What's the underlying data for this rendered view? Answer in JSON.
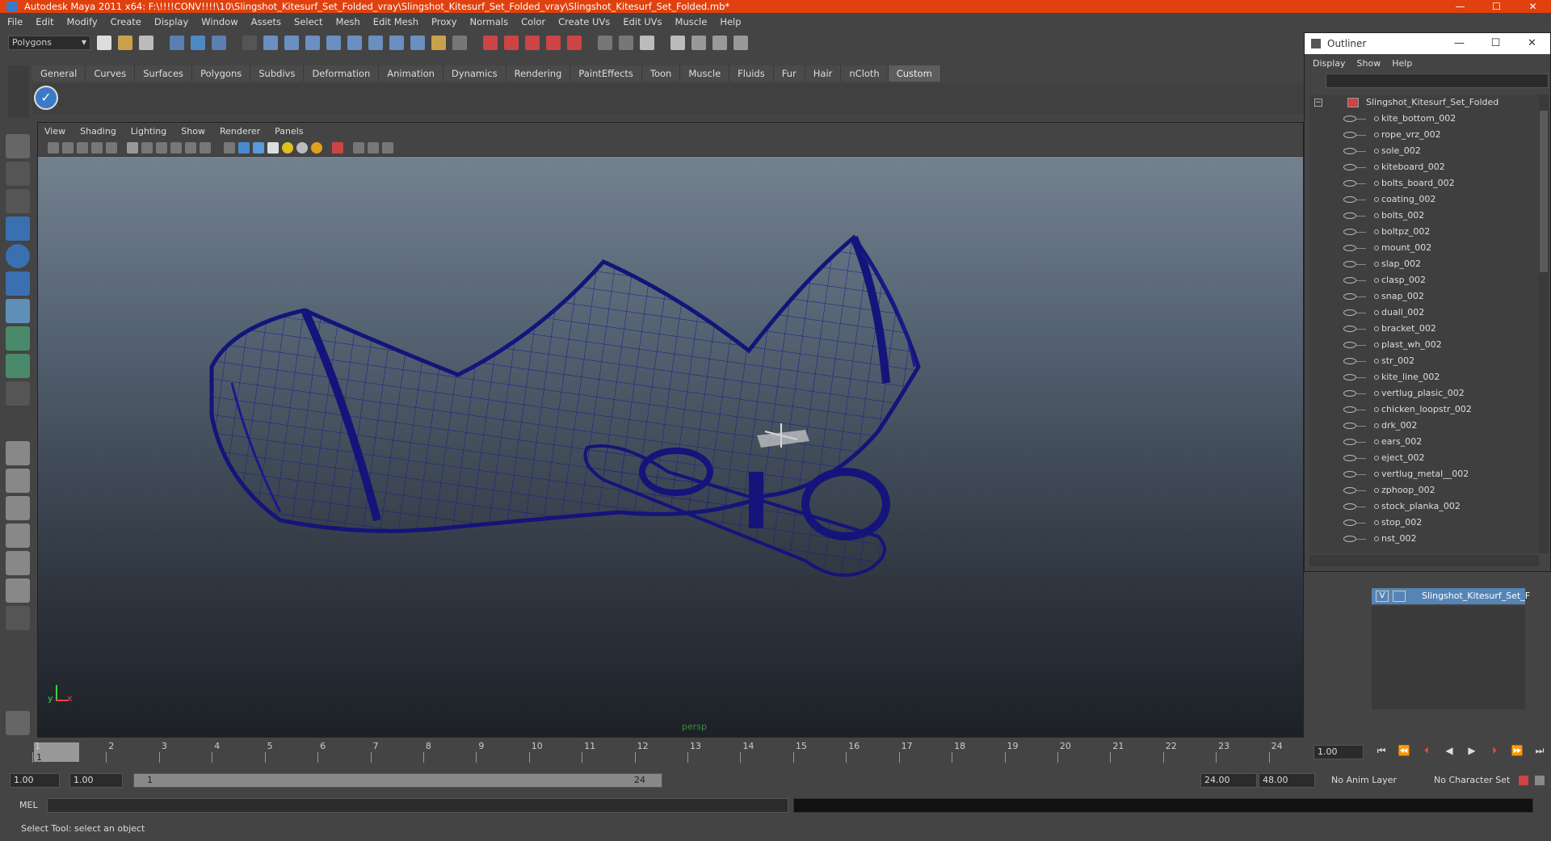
{
  "window": {
    "title": "Autodesk Maya 2011 x64: F:\\!!!!CONV!!!!\\10\\Slingshot_Kitesurf_Set_Folded_vray\\Slingshot_Kitesurf_Set_Folded_vray\\Slingshot_Kitesurf_Set_Folded.mb*",
    "minimize": "—",
    "maximize": "☐",
    "close": "✕"
  },
  "menubar": [
    "File",
    "Edit",
    "Modify",
    "Create",
    "Display",
    "Window",
    "Assets",
    "Select",
    "Mesh",
    "Edit Mesh",
    "Proxy",
    "Normals",
    "Color",
    "Create UVs",
    "Edit UVs",
    "Muscle",
    "Help"
  ],
  "toolbar": {
    "mode": "Polygons"
  },
  "shelf": {
    "tabs": [
      "General",
      "Curves",
      "Surfaces",
      "Polygons",
      "Subdivs",
      "Deformation",
      "Animation",
      "Dynamics",
      "Rendering",
      "PaintEffects",
      "Toon",
      "Muscle",
      "Fluids",
      "Fur",
      "Hair",
      "nCloth",
      "Custom"
    ],
    "active": "Custom"
  },
  "viewport": {
    "menu": [
      "View",
      "Shading",
      "Lighting",
      "Show",
      "Renderer",
      "Panels"
    ],
    "camera_label": "persp",
    "axis_y": "y",
    "axis_x": "x"
  },
  "outliner": {
    "title": "Outliner",
    "menu": [
      "Display",
      "Show",
      "Help"
    ],
    "root": "Slingshot_Kitesurf_Set_Folded",
    "items": [
      "kite_bottom_002",
      "rope_vrz_002",
      "sole_002",
      "kiteboard_002",
      "bolts_board_002",
      "coating_002",
      "bolts_002",
      "boltpz_002",
      "mount_002",
      "slap_002",
      "clasp_002",
      "snap_002",
      "duall_002",
      "bracket_002",
      "plast_wh_002",
      "str_002",
      "kite_line_002",
      "vertlug_plasic_002",
      "chicken_loopstr_002",
      "drk_002",
      "ears_002",
      "eject_002",
      "vertlug_metal__002",
      "zphoop_002",
      "stock_planka_002",
      "stop_002",
      "nst_002"
    ]
  },
  "layers": {
    "visible": "V",
    "name": "Slingshot_Kitesurf_Set_F"
  },
  "timeline": {
    "ticks": [
      "1",
      "2",
      "3",
      "4",
      "5",
      "6",
      "7",
      "8",
      "9",
      "10",
      "11",
      "12",
      "13",
      "14",
      "15",
      "16",
      "17",
      "18",
      "19",
      "20",
      "21",
      "22",
      "23",
      "24"
    ],
    "current_frame": "1",
    "current_time": "1.00"
  },
  "range": {
    "start": "1.00",
    "start2": "1.00",
    "range_start": "1",
    "range_end": "24",
    "end": "24.00",
    "end2": "48.00",
    "anim_layer": "No Anim Layer",
    "char_set": "No Character Set"
  },
  "command": {
    "label": "MEL"
  },
  "status": {
    "text": "Select Tool: select an object"
  },
  "colors": {
    "title_bar": "#e0410e",
    "wireframe": "#1a1a8a",
    "layer_highlight": "#5585b5"
  }
}
